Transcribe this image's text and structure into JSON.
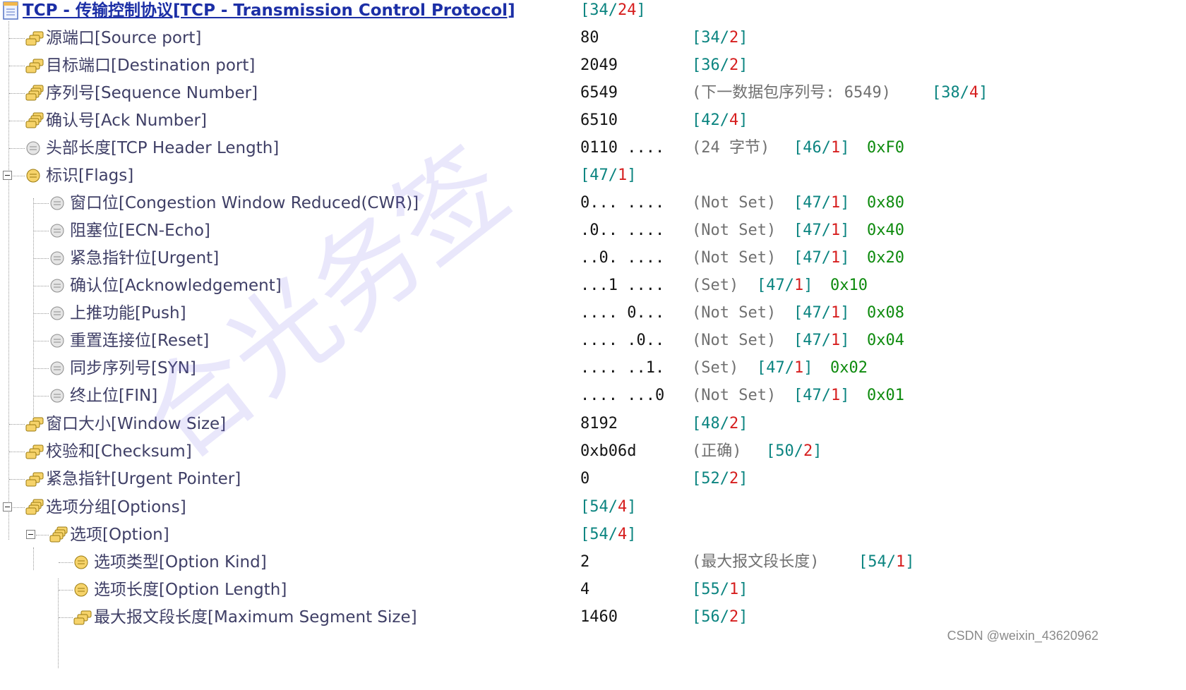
{
  "tree": {
    "root": {
      "label": "TCP - 传输控制协议[TCP - Transmission Control Protocol]",
      "offset": "34",
      "length": "24"
    },
    "source_port": {
      "label": "源端口[Source port]",
      "value": "80",
      "offset": "34",
      "length": "2"
    },
    "dest_port": {
      "label": "目标端口[Destination port]",
      "value": "2049",
      "offset": "36",
      "length": "2"
    },
    "seq": {
      "label": "序列号[Sequence Number]",
      "value": "6549",
      "note": "(下一数据包序列号: 6549)",
      "offset": "38",
      "length": "4"
    },
    "ack": {
      "label": "确认号[Ack Number]",
      "value": "6510",
      "offset": "42",
      "length": "4"
    },
    "hdr_len": {
      "label": "头部长度[TCP Header Length]",
      "value": "0110 ....",
      "note": "(24 字节)",
      "offset": "46",
      "length": "1",
      "hex": "0xF0"
    },
    "flags": {
      "label": "标识[Flags]",
      "offset": "47",
      "length": "1"
    },
    "cwr": {
      "label": "窗口位[Congestion Window Reduced(CWR)]",
      "value": "0... ....",
      "note": "(Not Set)",
      "offset": "47",
      "length": "1",
      "hex": "0x80"
    },
    "ece": {
      "label": "阻塞位[ECN-Echo]",
      "value": ".0.. ....",
      "note": "(Not Set)",
      "offset": "47",
      "length": "1",
      "hex": "0x40"
    },
    "urg": {
      "label": "紧急指针位[Urgent]",
      "value": "..0. ....",
      "note": "(Not Set)",
      "offset": "47",
      "length": "1",
      "hex": "0x20"
    },
    "ackf": {
      "label": "确认位[Acknowledgement]",
      "value": "...1 ....",
      "note": "(Set)",
      "offset": "47",
      "length": "1",
      "hex": "0x10"
    },
    "psh": {
      "label": "上推功能[Push]",
      "value": ".... 0...",
      "note": "(Not Set)",
      "offset": "47",
      "length": "1",
      "hex": "0x08"
    },
    "rst": {
      "label": "重置连接位[Reset]",
      "value": ".... .0..",
      "note": "(Not Set)",
      "offset": "47",
      "length": "1",
      "hex": "0x04"
    },
    "syn": {
      "label": "同步序列号[SYN]",
      "value": ".... ..1.",
      "note": "(Set)",
      "offset": "47",
      "length": "1",
      "hex": "0x02"
    },
    "fin": {
      "label": "终止位[FIN]",
      "value": ".... ...0",
      "note": "(Not Set)",
      "offset": "47",
      "length": "1",
      "hex": "0x01"
    },
    "window": {
      "label": "窗口大小[Window Size]",
      "value": "8192",
      "offset": "48",
      "length": "2"
    },
    "checksum": {
      "label": "校验和[Checksum]",
      "value": "0xb06d",
      "note": "(正确)",
      "offset": "50",
      "length": "2"
    },
    "urgptr": {
      "label": "紧急指针[Urgent Pointer]",
      "value": "0",
      "offset": "52",
      "length": "2"
    },
    "options": {
      "label": "选项分组[Options]",
      "offset": "54",
      "length": "4"
    },
    "option": {
      "label": "选项[Option]",
      "offset": "54",
      "length": "4"
    },
    "opt_kind": {
      "label": "选项类型[Option Kind]",
      "value": "2",
      "note": "(最大报文段长度)",
      "offset": "54",
      "length": "1"
    },
    "opt_len": {
      "label": "选项长度[Option Length]",
      "value": "4",
      "offset": "55",
      "length": "1"
    },
    "mss": {
      "label": "最大报文段长度[Maximum Segment Size]",
      "value": "1460",
      "offset": "56",
      "length": "2"
    }
  },
  "watermark": "合光务签",
  "credit": "CSDN @weixin_43620962",
  "colors": {
    "label": "#3f3f66",
    "root": "#1c2fa6",
    "offset": "#0b8480",
    "length": "#d61e1e",
    "hex": "#0d8a0d",
    "note": "#707070"
  }
}
